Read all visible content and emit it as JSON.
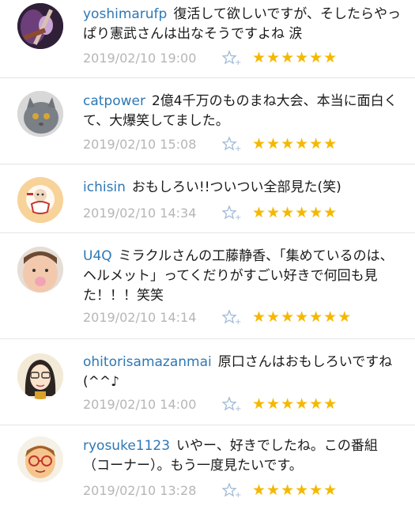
{
  "comments": [
    {
      "user": "yoshimarufp",
      "text": "復活して欲しいですが、そしたらやっぱり憲武さんは出なそうですよね 涙",
      "date": "2019/02/10 19:00",
      "stars": "★★★★★★",
      "rating": 6,
      "avatar": "guitar-photo"
    },
    {
      "user": "catpower",
      "text": "2億4千万のものまね大会、本当に面白くて、大爆笑してました。",
      "date": "2019/02/10 15:08",
      "stars": "★★★★★★",
      "rating": 6,
      "avatar": "cat-photo"
    },
    {
      "user": "ichisin",
      "text": "おもしろい!!ついつい全部見た(笑)",
      "date": "2019/02/10 14:34",
      "stars": "★★★★★★",
      "rating": 6,
      "avatar": "cartoon-character"
    },
    {
      "user": "U4Q",
      "text": "ミラクルさんの工藤静香、「集めているのは、ヘルメット」ってくだりがすごい好きで何回も見た！！！笑笑",
      "date": "2019/02/10 14:14",
      "stars": "★★★★★★★",
      "rating": 7,
      "avatar": "baby-photo"
    },
    {
      "user": "ohitorisamazanmai",
      "text": "原口さんはおもしろいですね(^^♪",
      "date": "2019/02/10 14:00",
      "stars": "★★★★★★",
      "rating": 6,
      "avatar": "anime-girl"
    },
    {
      "user": "ryosuke1123",
      "text": "いやー、好きでしたね。この番組（コーナー）。もう一度見たいです。",
      "date": "2019/02/10 13:28",
      "stars": "★★★★★★",
      "rating": 6,
      "avatar": "glasses-man"
    }
  ],
  "colors": {
    "username": "#2d78b5",
    "date": "#b6b6b6",
    "star": "#f5b800"
  },
  "icons": {
    "favorite": "star-plus-icon"
  }
}
